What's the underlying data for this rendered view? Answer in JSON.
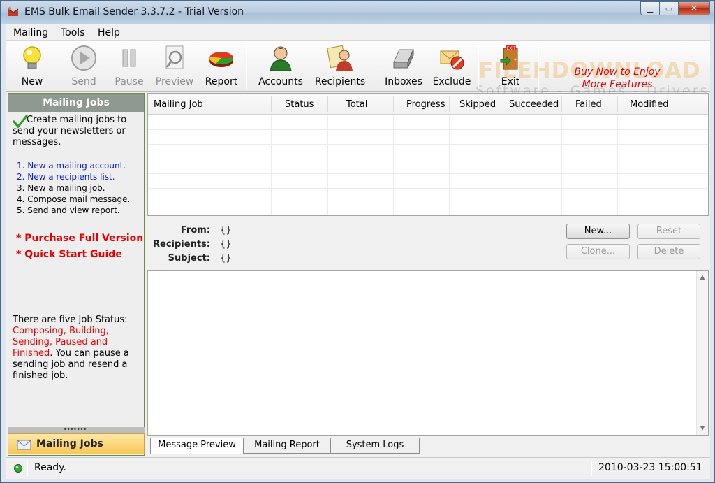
{
  "window": {
    "title": "EMS Bulk Email Sender 3.3.7.2 - Trial Version"
  },
  "menu": {
    "items": [
      "Mailing",
      "Tools",
      "Help"
    ]
  },
  "toolbar": {
    "buttons": [
      {
        "label": "New",
        "icon": "lightbulb-icon",
        "enabled": true
      },
      {
        "label": "Send",
        "icon": "play-icon",
        "enabled": false
      },
      {
        "label": "Pause",
        "icon": "pause-icon",
        "enabled": false
      },
      {
        "label": "Preview",
        "icon": "preview-magnifier-icon",
        "enabled": false
      },
      {
        "label": "Report",
        "icon": "pie-chart-icon",
        "enabled": true
      },
      {
        "label": "Accounts",
        "icon": "user-account-icon",
        "enabled": true
      },
      {
        "label": "Recipients",
        "icon": "recipients-icon",
        "enabled": true
      },
      {
        "label": "Inboxes",
        "icon": "inbox-icon",
        "enabled": true
      },
      {
        "label": "Exclude",
        "icon": "exclude-mail-icon",
        "enabled": true
      },
      {
        "label": "Exit",
        "icon": "exit-door-icon",
        "enabled": true
      }
    ],
    "promo_line1": "Buy Now to Enjoy",
    "promo_line2": "More Features",
    "watermark_line1": "FILEHDOWNLOAD",
    "watermark_line2": "Software - Games - Drivers"
  },
  "left_panel": {
    "header": "Mailing Jobs",
    "intro": "Create mailing jobs to send your newsletters or messages.",
    "steps": [
      {
        "text": "1. New a mailing account.",
        "link": true
      },
      {
        "text": "2. New a recipients list.",
        "link": true
      },
      {
        "text": "3. New a mailing job.",
        "link": false
      },
      {
        "text": "4. Compose mail message.",
        "link": false
      },
      {
        "text": "5. Send and view report.",
        "link": false
      }
    ],
    "purchase_link": "* Purchase Full Version",
    "quick_start_link": "* Quick Start Guide",
    "status_info_prefix": "There are five Job Status: ",
    "status_info_red": "Composing, Building, Sending, Paused and Finished",
    "status_info_suffix": ". You can pause a sending job and resend a finished job.",
    "grip": "•••••••",
    "nav_label": "Mailing Jobs"
  },
  "grid": {
    "columns": [
      "Mailing Job",
      "Status",
      "Total",
      "Progress",
      "Skipped",
      "Succeeded",
      "Failed",
      "Modified"
    ],
    "rows": []
  },
  "details": {
    "from_label": "From:",
    "from_value": "{}",
    "recipients_label": "Recipients:",
    "recipients_value": "{}",
    "subject_label": "Subject:",
    "subject_value": "{}",
    "new_button": "New...",
    "reset_button": "Reset",
    "clone_button": "Clone...",
    "delete_button": "Delete"
  },
  "tabs": [
    "Message Preview",
    "Mailing Report",
    "System Logs"
  ],
  "statusbar": {
    "text": "Ready.",
    "datetime": "2010-03-23 15:00:51"
  }
}
